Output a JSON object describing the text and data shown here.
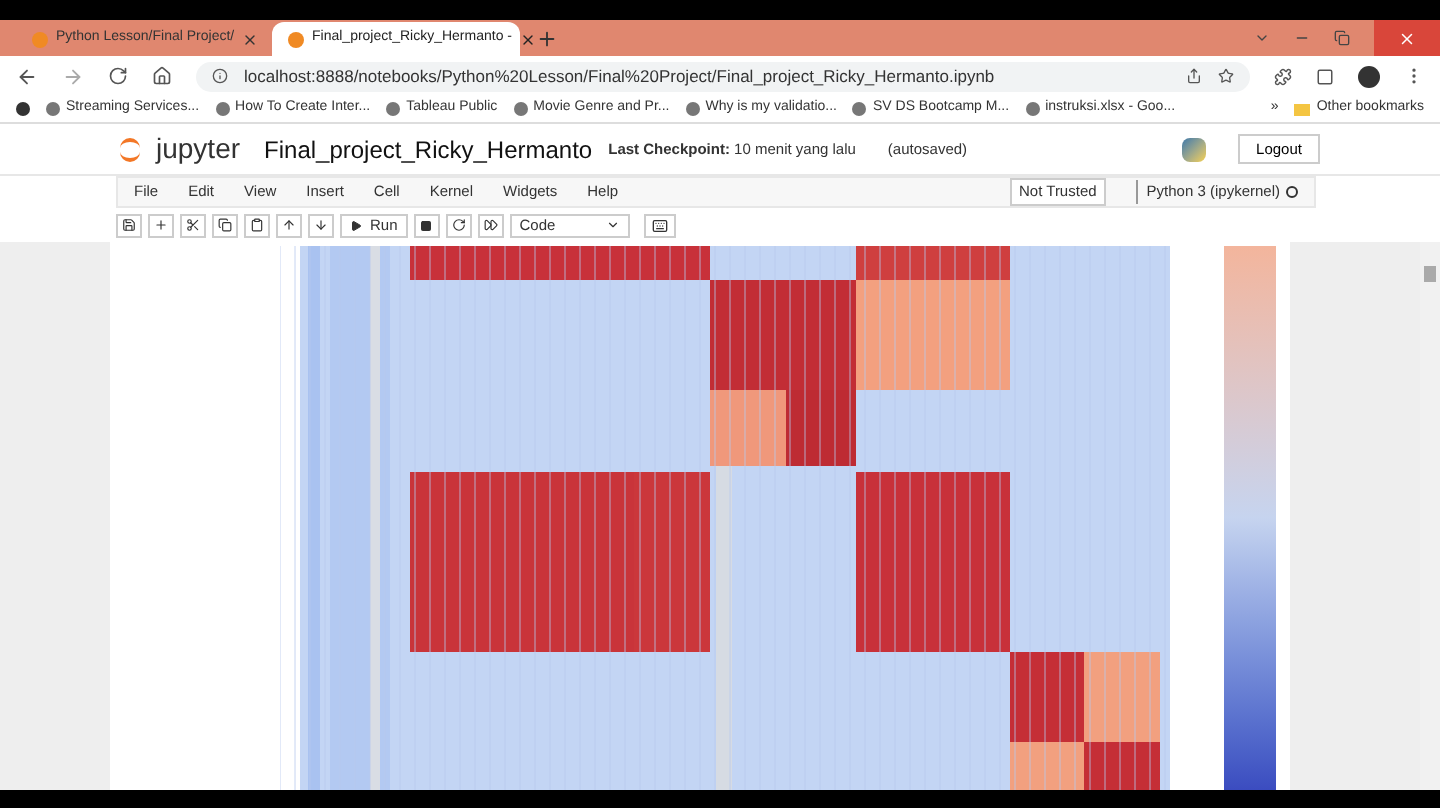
{
  "browser": {
    "tabs": [
      {
        "title": "Python Lesson/Final Project/",
        "selected": false
      },
      {
        "title": "Final_project_Ricky_Hermanto -",
        "selected": true
      }
    ],
    "url": "localhost:8888/notebooks/Python%20Lesson/Final%20Project/Final_project_Ricky_Hermanto.ipynb",
    "bookmarks": [
      "Streaming Services...",
      "How To Create Inter...",
      "Tableau Public",
      "Movie Genre and Pr...",
      "Why is my validatio...",
      "SV DS Bootcamp M...",
      "instruksi.xlsx - Goo..."
    ],
    "overflow": "»",
    "other_bookmarks": "Other bookmarks"
  },
  "jupyter": {
    "logo_text": "jupyter",
    "notebook_title": "Final_project_Ricky_Hermanto",
    "checkpoint_label": "Last Checkpoint:",
    "checkpoint_time": "10 menit yang lalu",
    "autosave": "(autosaved)",
    "logout": "Logout",
    "menu": [
      "File",
      "Edit",
      "View",
      "Insert",
      "Cell",
      "Kernel",
      "Widgets",
      "Help"
    ],
    "trust": "Not Trusted",
    "kernel": "Python 3 (ipykernel)",
    "run_label": "Run",
    "cell_type": "Code"
  }
}
